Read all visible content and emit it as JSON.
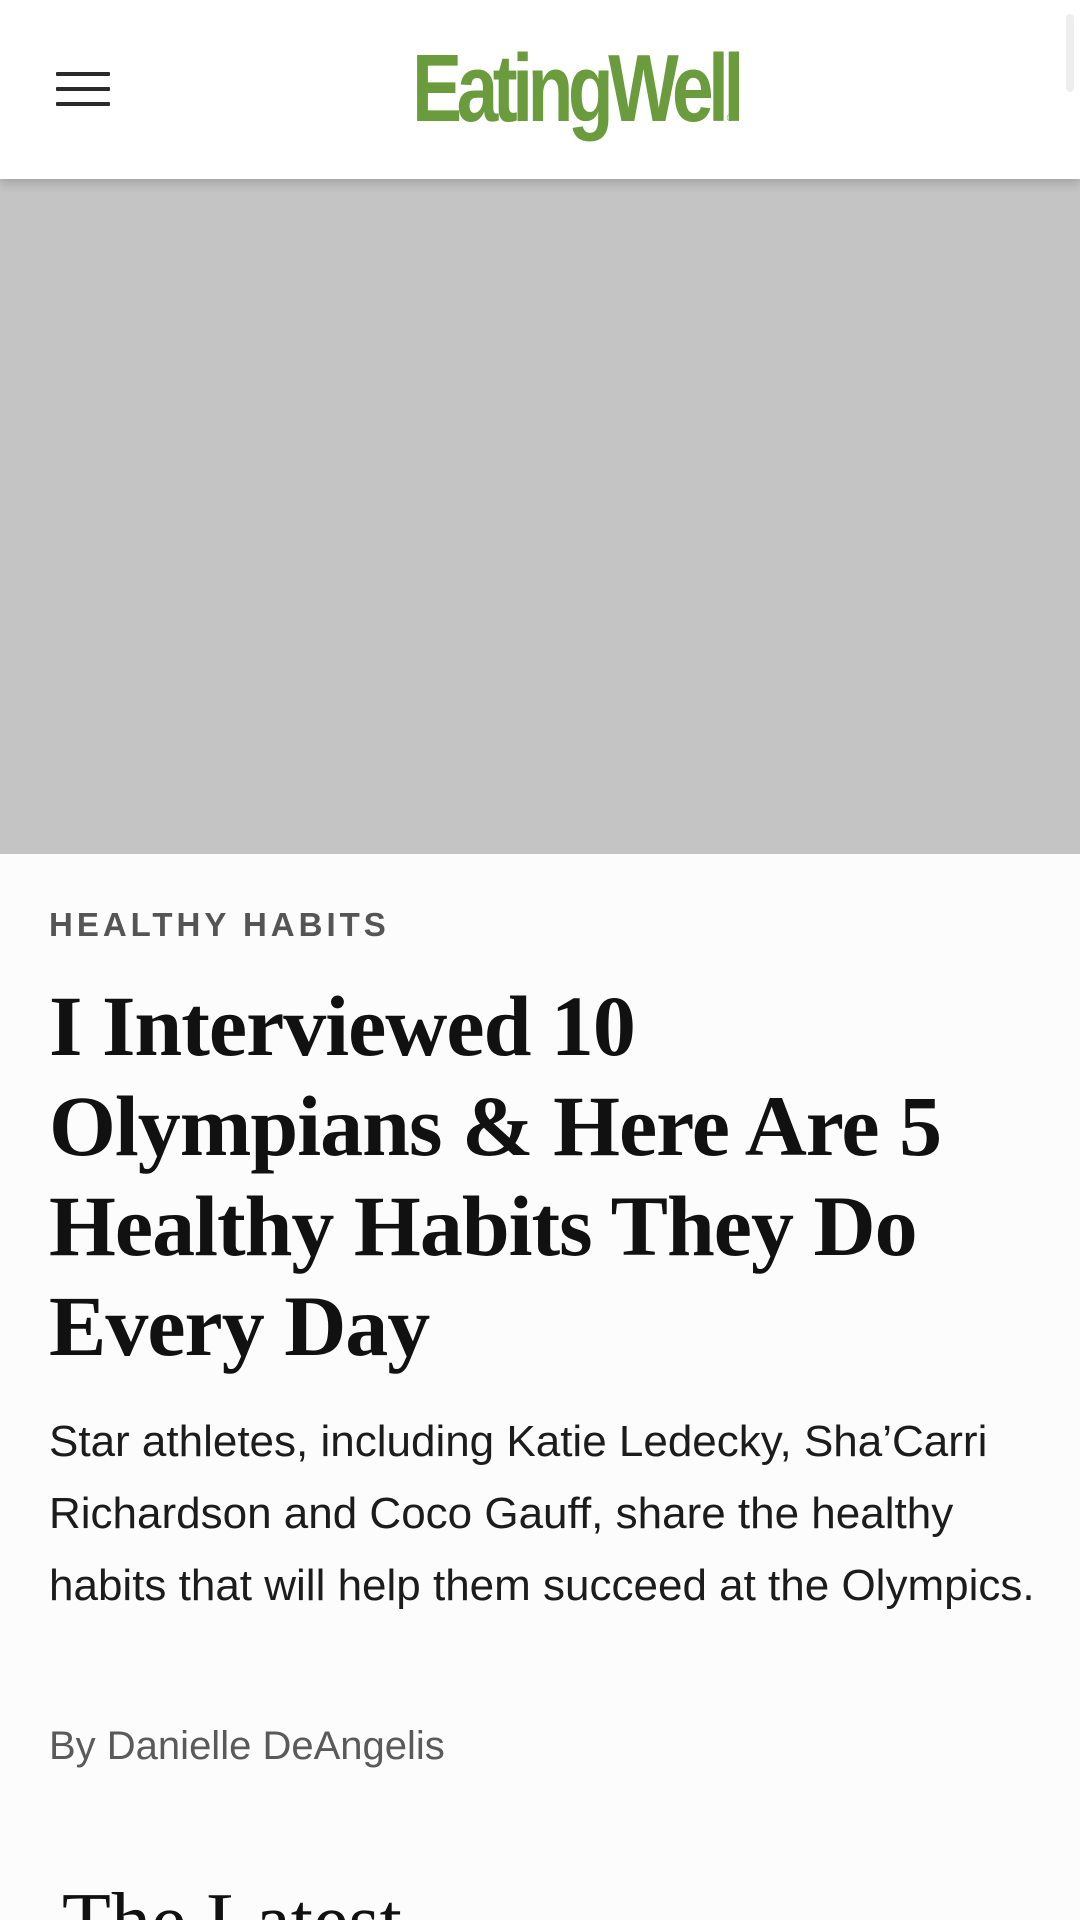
{
  "header": {
    "menu_label": "Menu",
    "logo_part1": "Eating",
    "logo_part2": "Well",
    "logo_reg": "®"
  },
  "colors": {
    "logo_green": "#6a9c3e",
    "image_placeholder": "#c4c4c4",
    "category_gray": "#555555",
    "headline": "#111111"
  },
  "article": {
    "category": "HEALTHY HABITS",
    "headline": "I Interviewed 10 Olympians & Here Are 5 Healthy Habits They Do Every Day",
    "dek": "Star athletes, including Katie Ledecky, Sha’Carri Richardson and Coco Gauff, share the healthy habits that will help them succeed at the Olympics.",
    "byline_prefix": "By ",
    "author": "Danielle DeAngelis"
  },
  "latest": {
    "heading": "The Latest"
  }
}
